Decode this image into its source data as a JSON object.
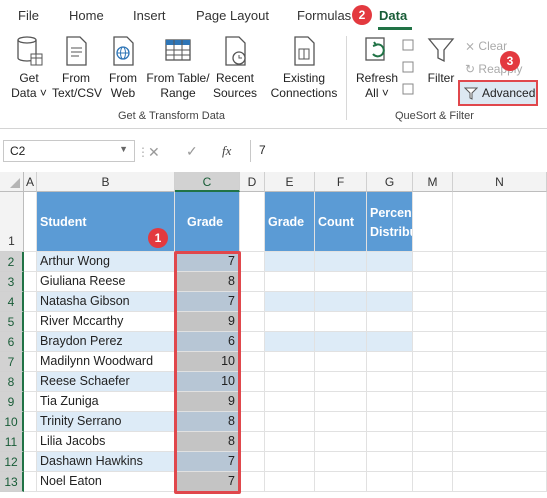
{
  "menu": {
    "file": "File",
    "home": "Home",
    "insert": "Insert",
    "page_layout": "Page Layout",
    "formulas": "Formulas",
    "data": "Data"
  },
  "ribbon": {
    "get_data": [
      "Get",
      "Data ˅"
    ],
    "from_text": [
      "From",
      "Text/CSV"
    ],
    "from_web": [
      "From",
      "Web"
    ],
    "from_table": [
      "From Table/",
      "Range"
    ],
    "recent_sources": [
      "Recent",
      "Sources"
    ],
    "existing_connections": [
      "Existing",
      "Connections"
    ],
    "refresh_all": [
      "Refresh",
      "All ˅"
    ],
    "filter": "Filter",
    "clear": "Clear",
    "reapply": "Reapply",
    "advanced": "Advanced",
    "group_get_transform": "Get & Transform Data",
    "group_sort_filter": "QueSort & Filter"
  },
  "badges": {
    "one": "1",
    "two": "2",
    "three": "3"
  },
  "formula": {
    "name_box": "C2",
    "fx": "fx",
    "value": "7",
    "cancel": "✕",
    "enter": "✓"
  },
  "columns": [
    "A",
    "B",
    "C",
    "D",
    "E",
    "F",
    "G",
    "M",
    "N"
  ],
  "rows": [
    "1",
    "2",
    "3",
    "4",
    "5",
    "6",
    "7",
    "8",
    "9",
    "10",
    "11",
    "12",
    "13"
  ],
  "headers": {
    "student": "Student",
    "grade": "Grade",
    "grade2": "Grade",
    "count": "Count",
    "percent": "Percen",
    "distrib": "Distribu"
  },
  "students": [
    {
      "name": "Arthur Wong",
      "grade": "7"
    },
    {
      "name": "Giuliana Reese",
      "grade": "8"
    },
    {
      "name": "Natasha Gibson",
      "grade": "7"
    },
    {
      "name": "River Mccarthy",
      "grade": "9"
    },
    {
      "name": "Braydon Perez",
      "grade": "6"
    },
    {
      "name": "Madilynn Woodward",
      "grade": "10"
    },
    {
      "name": "Reese Schaefer",
      "grade": "10"
    },
    {
      "name": "Tia Zuniga",
      "grade": "9"
    },
    {
      "name": "Trinity Serrano",
      "grade": "8"
    },
    {
      "name": "Lilia Jacobs",
      "grade": "8"
    },
    {
      "name": "Dashawn Hawkins",
      "grade": "7"
    },
    {
      "name": "Noel Eaton",
      "grade": "7"
    }
  ],
  "colors": {
    "accent": "#217346",
    "header_fill": "#5b9bd5",
    "band_fill": "#ddebf7",
    "highlight": "#e0474c"
  }
}
